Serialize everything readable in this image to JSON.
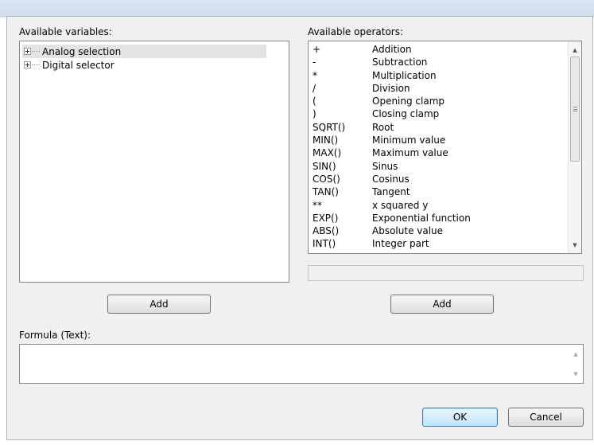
{
  "variables": {
    "label": "Available variables:",
    "items": [
      {
        "label": "Analog selection",
        "selected": true
      },
      {
        "label": "Digital selector",
        "selected": false
      }
    ],
    "add_label": "Add"
  },
  "operators": {
    "label": "Available operators:",
    "items": [
      {
        "symbol": "+",
        "description": "Addition"
      },
      {
        "symbol": "-",
        "description": "Subtraction"
      },
      {
        "symbol": "*",
        "description": "Multiplication"
      },
      {
        "symbol": "/",
        "description": "Division"
      },
      {
        "symbol": "(",
        "description": "Opening clamp"
      },
      {
        "symbol": ")",
        "description": "Closing clamp"
      },
      {
        "symbol": "SQRT()",
        "description": "Root"
      },
      {
        "symbol": "MIN()",
        "description": "Minimum value"
      },
      {
        "symbol": "MAX()",
        "description": "Maximum value"
      },
      {
        "symbol": "SIN()",
        "description": "Sinus"
      },
      {
        "symbol": "COS()",
        "description": "Cosinus"
      },
      {
        "symbol": "TAN()",
        "description": "Tangent"
      },
      {
        "symbol": "**",
        "description": "x squared y"
      },
      {
        "symbol": "EXP()",
        "description": "Exponential function"
      },
      {
        "symbol": "ABS()",
        "description": "Absolute value"
      },
      {
        "symbol": "INT()",
        "description": "Integer part"
      }
    ],
    "add_label": "Add",
    "status_text": ""
  },
  "formula": {
    "label": "Formula (Text):",
    "value": ""
  },
  "buttons": {
    "ok": "OK",
    "cancel": "Cancel"
  },
  "icons": {
    "scroll_up": "scroll-up-arrow-icon",
    "scroll_down": "scroll-down-arrow-icon",
    "expand": "tree-expand-plus-icon"
  }
}
